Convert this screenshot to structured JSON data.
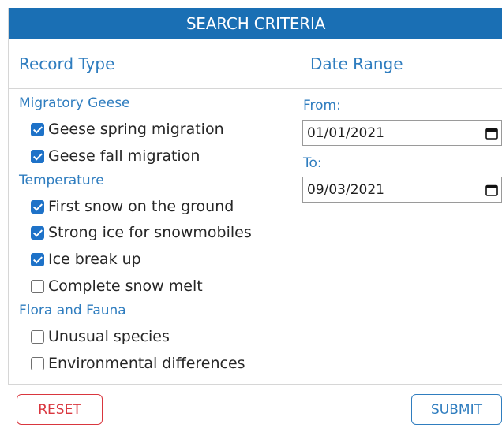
{
  "header": {
    "title": "SEARCH CRITERIA"
  },
  "columns": {
    "record_type": "Record Type",
    "date_range": "Date Range"
  },
  "groups": [
    {
      "title": "Migratory Geese",
      "items": [
        {
          "label": "Geese spring migration",
          "checked": true
        },
        {
          "label": "Geese fall migration",
          "checked": true
        }
      ]
    },
    {
      "title": "Temperature",
      "items": [
        {
          "label": "First snow on the ground",
          "checked": true
        },
        {
          "label": "Strong ice for snowmobiles",
          "checked": true
        },
        {
          "label": "Ice break up",
          "checked": true
        },
        {
          "label": "Complete snow melt",
          "checked": false
        }
      ]
    },
    {
      "title": "Flora and Fauna",
      "items": [
        {
          "label": "Unusual species",
          "checked": false
        },
        {
          "label": "Environmental differences",
          "checked": false
        }
      ]
    }
  ],
  "date": {
    "from_label": "From:",
    "from_value": "01/01/2021",
    "to_label": "To:",
    "to_value": "09/03/2021"
  },
  "buttons": {
    "reset": "RESET",
    "submit": "SUBMIT"
  },
  "colors": {
    "header_bg": "#1a6fb4",
    "accent": "#2f7dbf",
    "reset": "#d9363e",
    "checkbox": "#1e72c8"
  },
  "icons": {
    "checked": "checkbox-checked-icon",
    "unchecked": "checkbox-unchecked-icon",
    "calendar": "calendar-icon"
  }
}
